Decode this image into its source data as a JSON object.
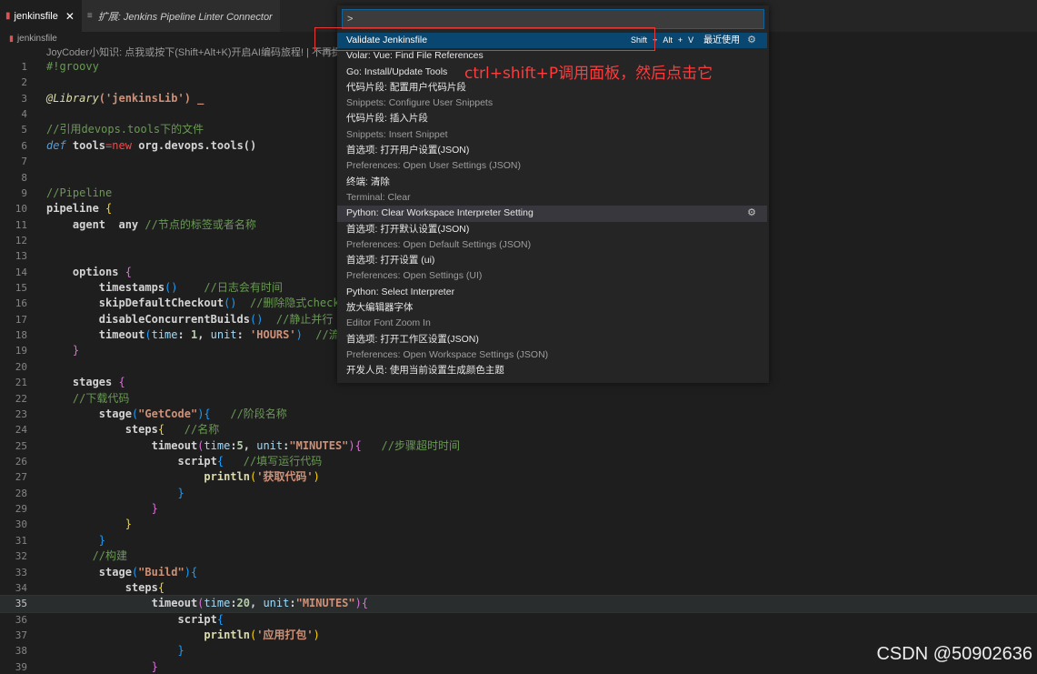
{
  "tabs": [
    {
      "label": "jenkinsfile",
      "close": "✕"
    },
    {
      "label": "扩展: Jenkins Pipeline Linter Connector"
    }
  ],
  "breadcrumb": "jenkinsfile",
  "codelens": "JoyCoder小知识: 点我或按下(Shift+Alt+K)开启AI编码旅程! | 不再提",
  "editor": {
    "current_line": 35,
    "line_numbers": [
      "1",
      "2",
      "3",
      "4",
      "5",
      "6",
      "7",
      "8",
      "9",
      "10",
      "11",
      "12",
      "13",
      "14",
      "15",
      "16",
      "17",
      "18",
      "19",
      "20",
      "21",
      "22",
      "23",
      "24",
      "25",
      "26",
      "27",
      "28",
      "29",
      "30",
      "31",
      "32",
      "33",
      "34",
      "35",
      "36",
      "37",
      "38",
      "39"
    ],
    "tokens": {
      "shebang": "#!groovy",
      "library_ann": "@Library",
      "library_arg": "('jenkinsLib') _",
      "c_ref": "//引用devops.tools下的文件",
      "def_kw": "def",
      "tools": " tools",
      "eq": "=",
      "new_kw": "new",
      "tools_class": " org.devops.tools()",
      "c_pipeline": "//Pipeline",
      "pipeline": "pipeline",
      "agent": "agent",
      "any": "  any ",
      "c_agent": "//节点的标签或者名称",
      "options": "options",
      "timestamps": "timestamps",
      "c_timestamps": "//日志会有时间",
      "skipDefaultCheckout": "skipDefaultCheckout",
      "c_skip": "//删除隐式checko",
      "disableConcurrentBuilds": "disableConcurrentBuilds",
      "c_disable": "//静止并行",
      "timeout": "timeout",
      "time_p": "time",
      "unit_p": "unit",
      "num_1": " 1",
      "str_hours": " 'HOURS'",
      "c_timeout1": "//流水",
      "stages": "stages",
      "c_download": "//下载代码",
      "stage": "stage",
      "str_getcode": "\"GetCode\"",
      "c_stage_name": "//阶段名称",
      "steps": "steps",
      "c_name": "//名称",
      "num_5": "5",
      "str_minutes": "\"MINUTES\"",
      "c_step_timeout": "//步骤超时时间",
      "script": "script",
      "c_script": "//填写运行代码",
      "println": "println",
      "str_getcode_cn": "'获取代码'",
      "c_build": "//构建",
      "str_build": "\"Build\"",
      "num_20": "20",
      "str_pack": "'应用打包'"
    }
  },
  "palette": {
    "input_value": ">",
    "items": [
      {
        "label": "Validate Jenkinsfile",
        "kind": "main",
        "selected": true,
        "keys": [
          "Shift",
          "+",
          "Alt",
          "+",
          "V"
        ],
        "recent": "最近使用"
      },
      {
        "label": "Volar: Vue: Find File References",
        "kind": "main"
      },
      {
        "label": "Go: Install/Update Tools",
        "kind": "main"
      },
      {
        "label": "代码片段: 配置用户代码片段",
        "kind": "main"
      },
      {
        "label": "Snippets: Configure User Snippets",
        "kind": "sub"
      },
      {
        "label": "代码片段: 插入片段",
        "kind": "main"
      },
      {
        "label": "Snippets: Insert Snippet",
        "kind": "sub"
      },
      {
        "label": "首选项: 打开用户设置(JSON)",
        "kind": "main"
      },
      {
        "label": "Preferences: Open User Settings (JSON)",
        "kind": "sub"
      },
      {
        "label": "终端: 清除",
        "kind": "main"
      },
      {
        "label": "Terminal: Clear",
        "kind": "sub"
      },
      {
        "label": "Python: Clear Workspace Interpreter Setting",
        "kind": "main",
        "hover": true
      },
      {
        "label": "首选项: 打开默认设置(JSON)",
        "kind": "main"
      },
      {
        "label": "Preferences: Open Default Settings (JSON)",
        "kind": "sub"
      },
      {
        "label": "首选项: 打开设置 (ui)",
        "kind": "main"
      },
      {
        "label": "Preferences: Open Settings (UI)",
        "kind": "sub"
      },
      {
        "label": "Python: Select Interpreter",
        "kind": "main"
      },
      {
        "label": "放大编辑器字体",
        "kind": "main"
      },
      {
        "label": "Editor Font Zoom In",
        "kind": "sub"
      },
      {
        "label": "首选项: 打开工作区设置(JSON)",
        "kind": "main"
      },
      {
        "label": "Preferences: Open Workspace Settings (JSON)",
        "kind": "sub"
      },
      {
        "label": "开发人员: 使用当前设置生成颜色主题",
        "kind": "main"
      }
    ]
  },
  "annotation": "ctrl+shift+P调用面板，然后点击它",
  "watermark": "CSDN @50902636",
  "colors": {
    "editor_bg": "#1e1e1e",
    "selection": "#094771",
    "annotation_red": "#ff3b3b",
    "comment": "#6a9955",
    "string": "#ce9178",
    "keyword": "#569cd6"
  }
}
